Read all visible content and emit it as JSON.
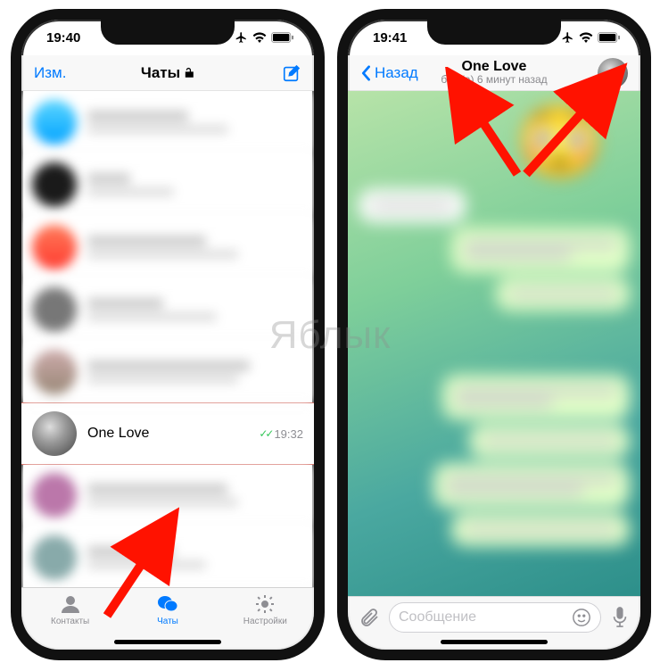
{
  "watermark": "Яблык",
  "left": {
    "time": "19:40",
    "nav": {
      "edit": "Изм.",
      "title": "Чаты"
    },
    "highlighted_chat": {
      "name": "One Love",
      "time": "19:32"
    },
    "tabs": {
      "contacts": "Контакты",
      "chats": "Чаты",
      "settings": "Настройки"
    }
  },
  "right": {
    "time": "19:41",
    "nav": {
      "back": "Назад",
      "title": "One Love",
      "subtitle": "был(а) 6 минут назад"
    },
    "input": {
      "placeholder": "Сообщение"
    }
  }
}
